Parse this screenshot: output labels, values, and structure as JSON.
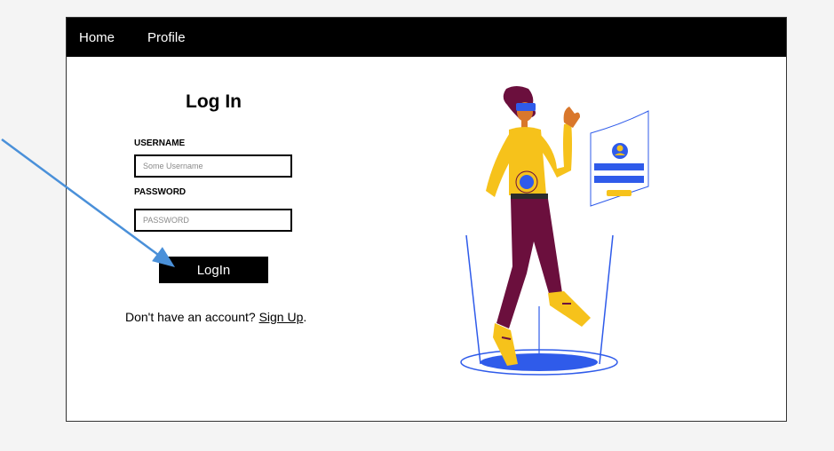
{
  "nav": {
    "home_label": "Home",
    "profile_label": "Profile"
  },
  "login": {
    "title": "Log In",
    "username_label": "USERNAME",
    "username_placeholder": "Some Username",
    "password_label": "PASSWORD",
    "password_placeholder": "PASSWORD",
    "button_label": "LogIn",
    "signup_prefix": "Don't have an account? ",
    "signup_link": "Sign Up",
    "signup_suffix": "."
  },
  "colors": {
    "navbar": "#000000",
    "accent_blue": "#2f5bea",
    "figure_yellow": "#f6c21b",
    "figure_pants": "#6b0f3d",
    "arrow": "#4a90d9"
  },
  "icons": {
    "illustration": "vr-login-illustration",
    "arrow": "annotation-arrow"
  }
}
